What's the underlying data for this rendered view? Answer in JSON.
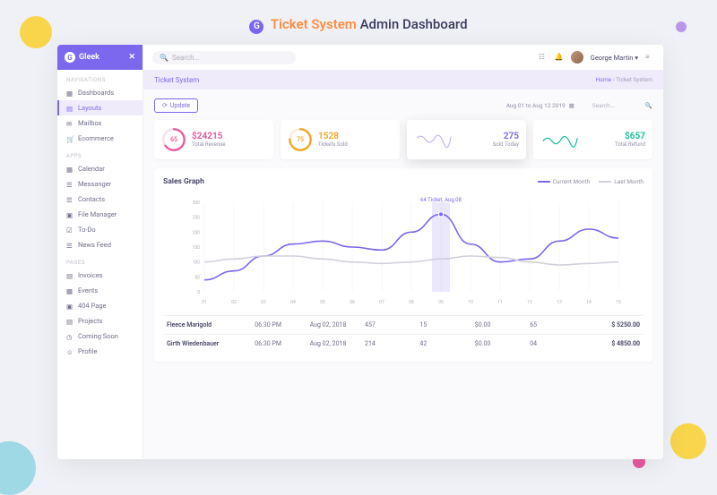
{
  "page_heading": {
    "brand": "G",
    "orange": "Ticket System",
    "dark": "Admin Dashboard"
  },
  "brand": {
    "name": "Gleek",
    "logo": "G"
  },
  "sidebar": {
    "sections": {
      "navigations": "NAVIGATIONS",
      "apps": "APPS",
      "pages": "PAGES"
    },
    "items": {
      "dashboards": "Dashboards",
      "layouts": "Layouts",
      "mailbox": "Mailbox",
      "ecommerce": "Ecommerce",
      "calendar": "Calendar",
      "messanger": "Messanger",
      "contacts": "Contacts",
      "file_manager": "File Manager",
      "todo": "To-Do",
      "news_feed": "News Feed",
      "invoices": "Invoices",
      "events": "Events",
      "page404": "404 Page",
      "projects": "Projects",
      "coming_soon": "Coming Soon",
      "profile": "Profile"
    }
  },
  "topbar": {
    "search_placeholder": "Search...",
    "user": "George Martin"
  },
  "breadcrumb": {
    "title": "Ticket System",
    "home": "Home",
    "current": "Ticket System"
  },
  "toolbar": {
    "update": "Update",
    "date_range": "Aug 01 to Aug 12 2019",
    "search_placeholder": "Search..."
  },
  "stats": {
    "revenue": {
      "pct": "65",
      "value": "$24215",
      "label": "Total Revenue",
      "color": "#e85a9f"
    },
    "tickets": {
      "pct": "75",
      "value": "1528",
      "label": "Tickets Sold",
      "color": "#f5a623"
    },
    "sold_today": {
      "value": "275",
      "label": "Sold Today",
      "color": "#7b68ee"
    },
    "refund": {
      "value": "$657",
      "label": "Total Refund",
      "color": "#1dbf9f"
    }
  },
  "chart": {
    "title": "Sales Graph",
    "legend": {
      "current": "Current Month",
      "last": "Last Month"
    },
    "tooltip": "64 Ticket, Aug 08"
  },
  "chart_data": {
    "type": "line",
    "xlabel": "",
    "ylabel": "",
    "ylim": [
      0,
      300
    ],
    "y_ticks": [
      0,
      50,
      100,
      150,
      200,
      250,
      300
    ],
    "x_ticks": [
      "01",
      "02",
      "03",
      "04",
      "05",
      "06",
      "07",
      "08",
      "09",
      "10",
      "11",
      "12",
      "13",
      "14",
      "15"
    ],
    "series": [
      {
        "name": "Current Month",
        "color": "#7b68ee",
        "values": [
          40,
          70,
          120,
          160,
          170,
          150,
          140,
          200,
          260,
          160,
          100,
          110,
          170,
          210,
          180
        ]
      },
      {
        "name": "Last Month",
        "color": "#d0d0dc",
        "values": [
          100,
          110,
          120,
          120,
          110,
          100,
          95,
          100,
          110,
          120,
          115,
          100,
          90,
          95,
          100
        ]
      }
    ],
    "highlight": {
      "index": 8,
      "label": "64 Ticket, Aug 08"
    }
  },
  "table": {
    "rows": [
      {
        "name": "Fleece Marigold",
        "time": "06:30 PM",
        "date": "Aug 02, 2018",
        "c1": "457",
        "c2": "15",
        "c3": "$0.00",
        "c4": "65",
        "amount": "$ 5250.00"
      },
      {
        "name": "Girth Wiedenbauer",
        "time": "06:30 PM",
        "date": "Aug 02, 2018",
        "c1": "214",
        "c2": "42",
        "c3": "$0.00",
        "c4": "04",
        "amount": "$ 4850.00"
      }
    ]
  }
}
